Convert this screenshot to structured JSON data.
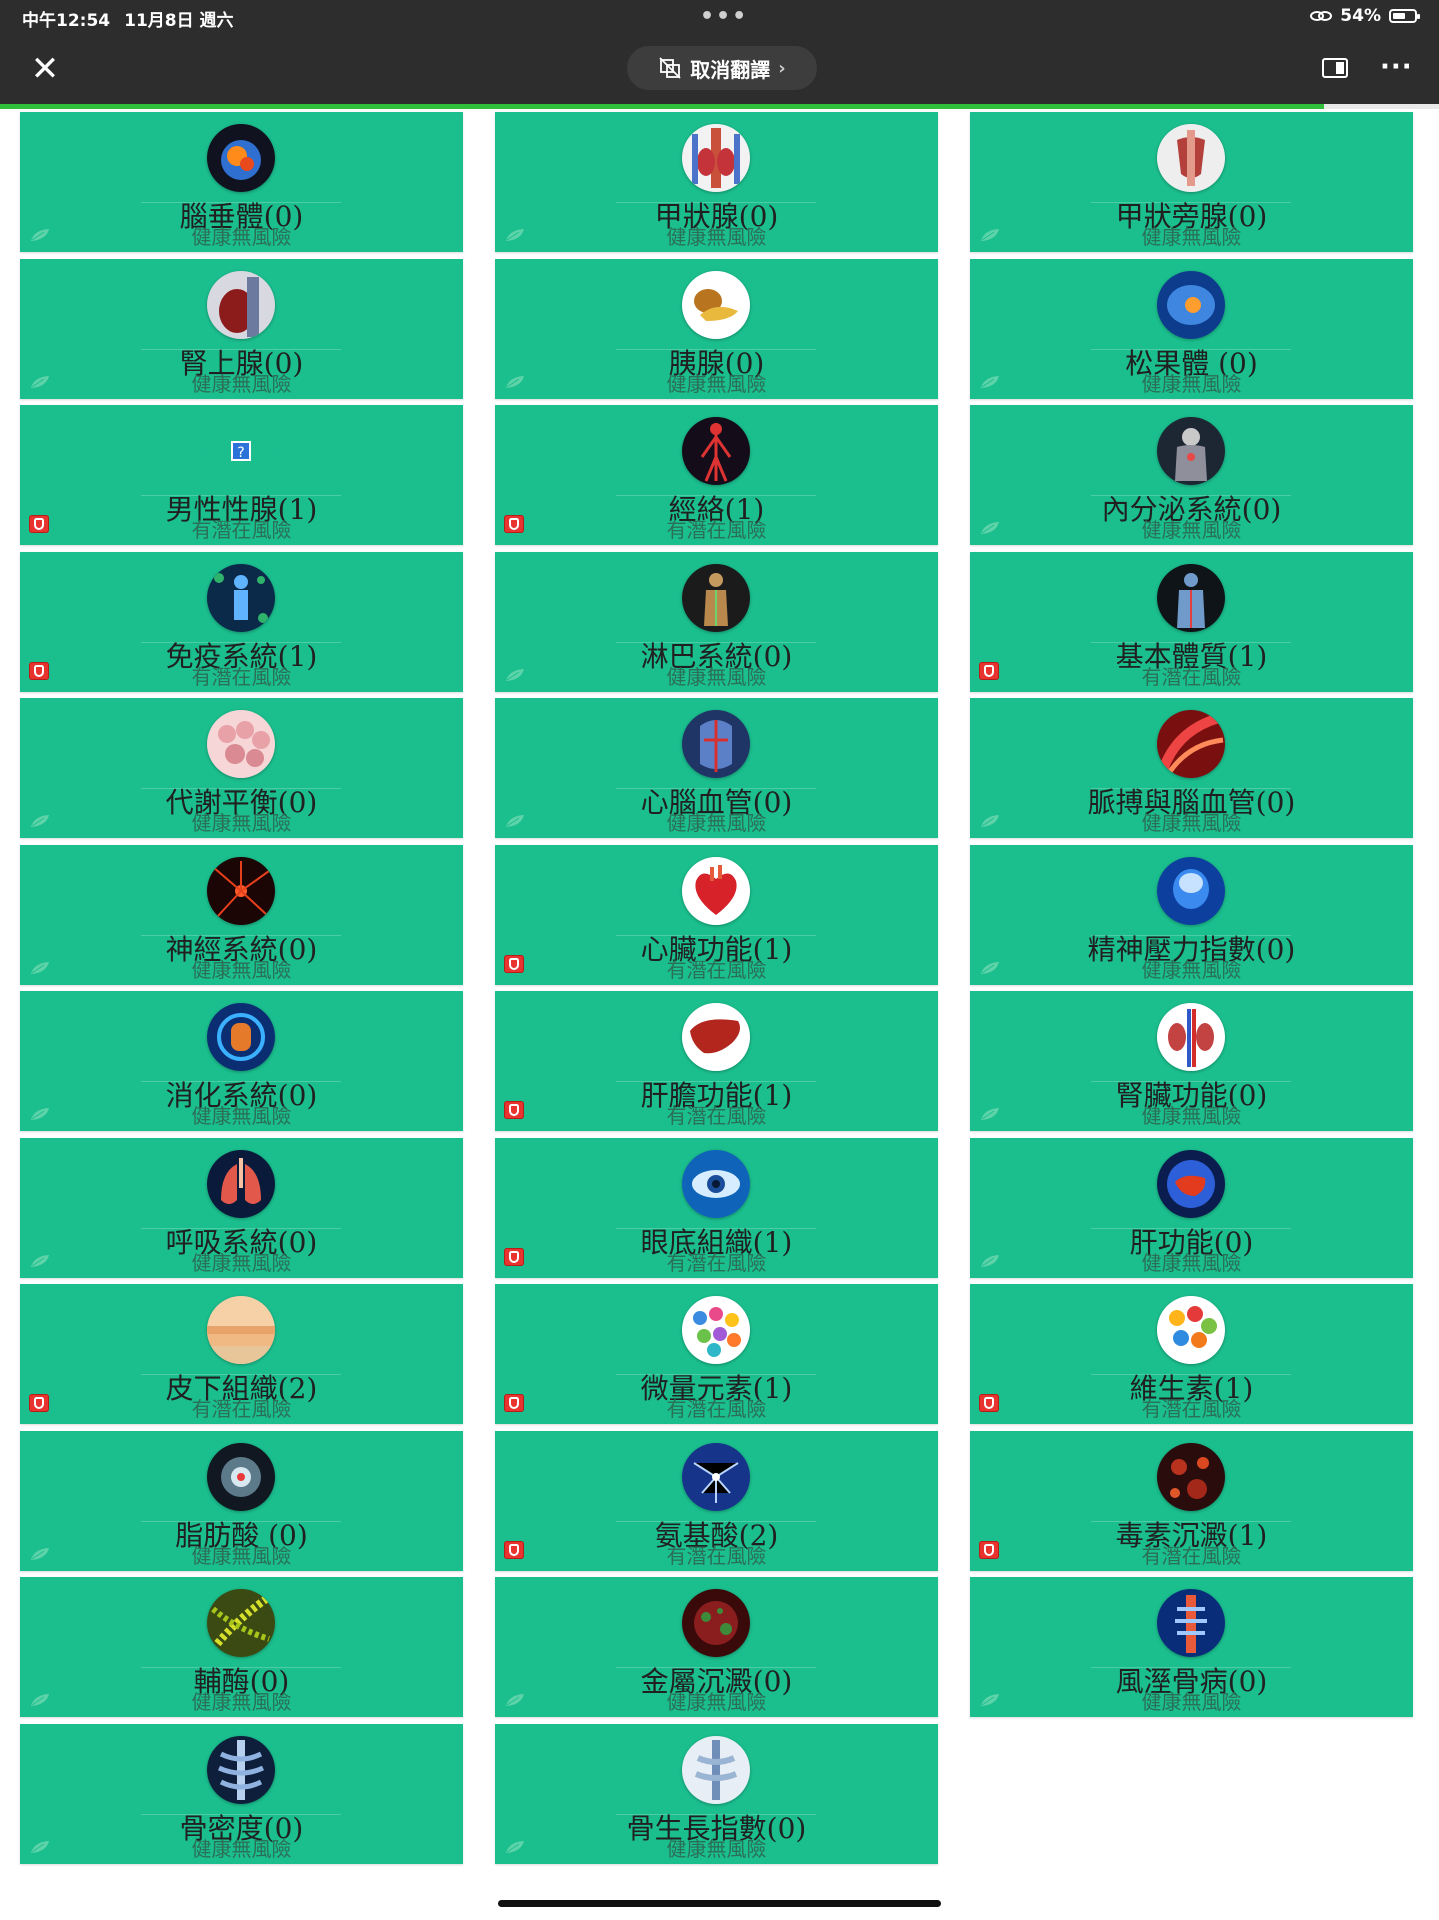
{
  "status_bar": {
    "time": "中午12:54",
    "date": "11月8日 週六",
    "battery": "54%"
  },
  "toolbar": {
    "translate_label": "取消翻譯",
    "close_icon": "close-icon",
    "split_icon": "split-view-icon",
    "more_icon": "more-icon"
  },
  "page_progress": 0.92,
  "colors": {
    "card": "#1bbf8e",
    "risk": "#e8332e",
    "topbar": "#2d2d2d",
    "progress": "#2fbf3a"
  },
  "status_labels": {
    "healthy": "健康無風險",
    "risk": "有潛在風險"
  },
  "items": [
    {
      "title": "腦垂體(0)",
      "status": "健康無風險",
      "risk": false,
      "icon": "brain-icon"
    },
    {
      "title": "甲狀腺(0)",
      "status": "健康無風險",
      "risk": false,
      "icon": "thyroid-icon"
    },
    {
      "title": "甲狀旁腺(0)",
      "status": "健康無風險",
      "risk": false,
      "icon": "parathyroid-icon"
    },
    {
      "title": "腎上腺(0)",
      "status": "健康無風險",
      "risk": false,
      "icon": "adrenal-icon"
    },
    {
      "title": "胰腺(0)",
      "status": "健康無風險",
      "risk": false,
      "icon": "pancreas-icon"
    },
    {
      "title": "松果體 (0)",
      "status": "健康無風險",
      "risk": false,
      "icon": "pineal-icon"
    },
    {
      "title": "男性性腺(1)",
      "status": "有潛在風險",
      "risk": true,
      "icon": "missing-image-icon"
    },
    {
      "title": "經絡(1)",
      "status": "有潛在風險",
      "risk": true,
      "icon": "meridian-icon"
    },
    {
      "title": "內分泌系統(0)",
      "status": "健康無風險",
      "risk": false,
      "icon": "endocrine-icon"
    },
    {
      "title": "免疫系統(1)",
      "status": "有潛在風險",
      "risk": true,
      "icon": "immune-icon"
    },
    {
      "title": "淋巴系統(0)",
      "status": "健康無風險",
      "risk": false,
      "icon": "lymph-icon"
    },
    {
      "title": "基本體質(1)",
      "status": "有潛在風險",
      "risk": true,
      "icon": "body-icon"
    },
    {
      "title": "代謝平衡(0)",
      "status": "健康無風險",
      "risk": false,
      "icon": "metabolism-icon"
    },
    {
      "title": "心腦血管(0)",
      "status": "健康無風險",
      "risk": false,
      "icon": "cardio-icon"
    },
    {
      "title": "脈搏與腦血管(0)",
      "status": "健康無風險",
      "risk": false,
      "icon": "vessel-icon"
    },
    {
      "title": "神經系統(0)",
      "status": "健康無風險",
      "risk": false,
      "icon": "neuron-icon"
    },
    {
      "title": "心臟功能(1)",
      "status": "有潛在風險",
      "risk": true,
      "icon": "heart-icon"
    },
    {
      "title": "精神壓力指數(0)",
      "status": "健康無風險",
      "risk": false,
      "icon": "head-icon"
    },
    {
      "title": "消化系統(0)",
      "status": "健康無風險",
      "risk": false,
      "icon": "digestive-icon"
    },
    {
      "title": "肝膽功能(1)",
      "status": "有潛在風險",
      "risk": true,
      "icon": "liver-icon"
    },
    {
      "title": "腎臟功能(0)",
      "status": "健康無風險",
      "risk": false,
      "icon": "kidney-icon"
    },
    {
      "title": "呼吸系統(0)",
      "status": "健康無風險",
      "risk": false,
      "icon": "lungs-icon"
    },
    {
      "title": "眼底組織(1)",
      "status": "有潛在風險",
      "risk": true,
      "icon": "eye-icon"
    },
    {
      "title": "肝功能(0)",
      "status": "健康無風險",
      "risk": false,
      "icon": "liver-glow-icon"
    },
    {
      "title": "皮下組織(2)",
      "status": "有潛在風險",
      "risk": true,
      "icon": "skin-icon"
    },
    {
      "title": "微量元素(1)",
      "status": "有潛在風險",
      "risk": true,
      "icon": "elements-icon"
    },
    {
      "title": "維生素(1)",
      "status": "有潛在風險",
      "risk": true,
      "icon": "vitamin-icon"
    },
    {
      "title": "脂肪酸 (0)",
      "status": "健康無風險",
      "risk": false,
      "icon": "fatty-acid-icon"
    },
    {
      "title": "氨基酸(2)",
      "status": "有潛在風險",
      "risk": true,
      "icon": "amino-acid-icon"
    },
    {
      "title": "毒素沉澱(1)",
      "status": "有潛在風險",
      "risk": true,
      "icon": "toxin-icon"
    },
    {
      "title": "輔酶(0)",
      "status": "健康無風險",
      "risk": false,
      "icon": "coenzyme-icon"
    },
    {
      "title": "金屬沉澱(0)",
      "status": "健康無風險",
      "risk": false,
      "icon": "metal-icon"
    },
    {
      "title": "風溼骨病(0)",
      "status": "健康無風險",
      "risk": false,
      "icon": "spine-icon"
    },
    {
      "title": "骨密度(0)",
      "status": "健康無風險",
      "risk": false,
      "icon": "bone-density-icon"
    },
    {
      "title": "骨生長指數(0)",
      "status": "健康無風險",
      "risk": false,
      "icon": "bone-growth-icon"
    }
  ]
}
